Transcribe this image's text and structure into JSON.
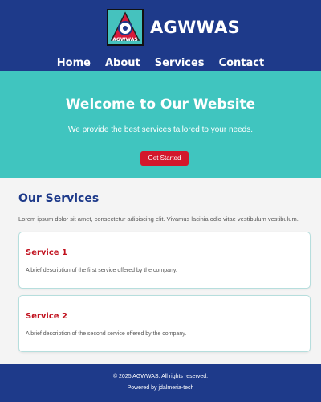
{
  "header": {
    "brand_name": "AGWWAS",
    "logo_text": "AGWWAS",
    "nav": [
      "Home",
      "About",
      "Services",
      "Contact"
    ]
  },
  "hero": {
    "title": "Welcome to Our Website",
    "subtitle": "We provide the best services tailored to your needs.",
    "cta_label": "Get Started"
  },
  "services": {
    "heading": "Our Services",
    "intro": "Lorem ipsum dolor sit amet, consectetur adipiscing elit. Vivamus lacinia odio vitae vestibulum vestibulum.",
    "cards": [
      {
        "title": "Service 1",
        "description": "A brief description of the first service offered by the company."
      },
      {
        "title": "Service 2",
        "description": "A brief description of the second service offered by the company."
      }
    ]
  },
  "footer": {
    "copyright": "© 2025 AGWWAS. All rights reserved.",
    "powered": "Powered by jdalmeria-tech"
  },
  "colors": {
    "header_bg": "#1e3a8a",
    "hero_bg": "#40c5bf",
    "accent_red": "#d3172b",
    "heading_blue": "#1e3a8a"
  }
}
